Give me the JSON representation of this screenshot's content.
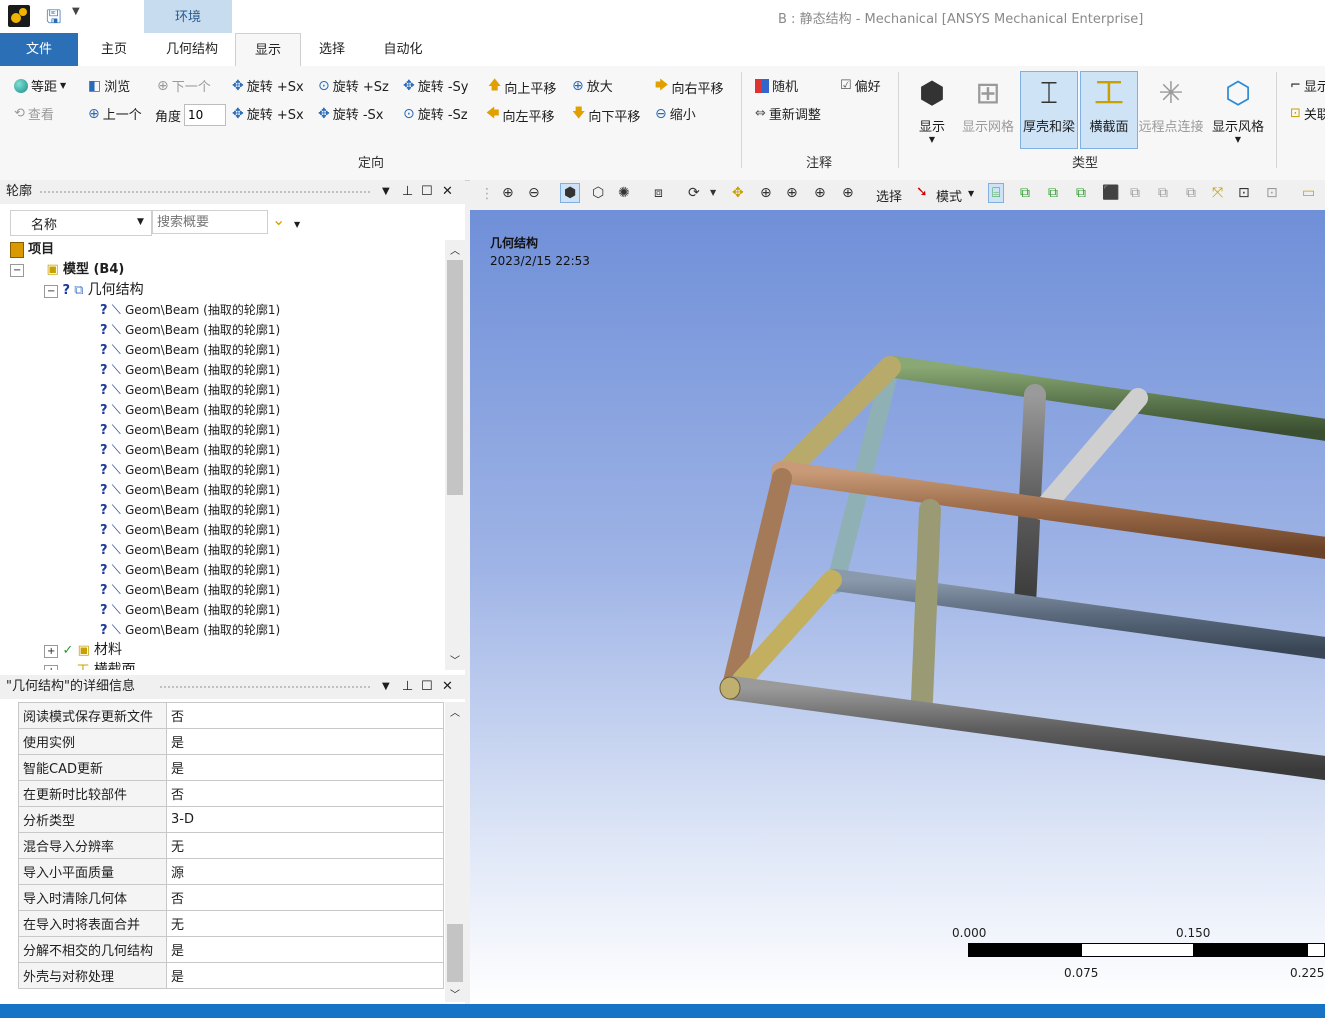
{
  "window": {
    "title": "B : 静态结构 - Mechanical [ANSYS Mechanical Enterprise]",
    "context_tab": "环境"
  },
  "menu": {
    "file": "文件",
    "tabs": [
      "主页",
      "几何结构",
      "显示",
      "选择",
      "自动化"
    ],
    "active": "显示"
  },
  "ribbon": {
    "orient": {
      "group_label": "定向",
      "isometric": "等距",
      "browse": "浏览",
      "next": "下一个",
      "previous": "上一个",
      "view": "查看",
      "angle_label": "角度",
      "angle_value": "10",
      "rot_pos_sx_1": "旋转 +Sx",
      "rot_pos_sz": "旋转 +Sz",
      "rot_neg_sy": "旋转 -Sy",
      "pan_up": "向上平移",
      "zoom_in": "放大",
      "pan_right": "向右平移",
      "rot_pos_sx_2": "旋转 +Sx",
      "rot_neg_sx": "旋转 -Sx",
      "rot_neg_sz": "旋转 -Sz",
      "pan_left": "向左平移",
      "pan_down": "向下平移",
      "zoom_out": "缩小"
    },
    "annotation": {
      "group_label": "注释",
      "random": "随机",
      "preference": "偏好",
      "rescale": "重新调整"
    },
    "type": {
      "group_label": "类型",
      "display": "显示",
      "show_mesh": "显示网格",
      "thick_beam": "厚壳和梁",
      "cross_section": "横截面",
      "remote_point": "远程点连接",
      "display_style": "显示风格"
    },
    "extra": {
      "show": "显示",
      "related": "关联"
    }
  },
  "outline": {
    "title": "轮廓",
    "filter_label": "名称",
    "search_placeholder": "搜索概要",
    "project": "项目",
    "model": "模型 (B4)",
    "geometry": "几何结构",
    "beam_items": [
      "Geom\\Beam (抽取的轮廓1)",
      "Geom\\Beam (抽取的轮廓1)",
      "Geom\\Beam (抽取的轮廓1)",
      "Geom\\Beam (抽取的轮廓1)",
      "Geom\\Beam (抽取的轮廓1)",
      "Geom\\Beam (抽取的轮廓1)",
      "Geom\\Beam (抽取的轮廓1)",
      "Geom\\Beam (抽取的轮廓1)",
      "Geom\\Beam (抽取的轮廓1)",
      "Geom\\Beam (抽取的轮廓1)",
      "Geom\\Beam (抽取的轮廓1)",
      "Geom\\Beam (抽取的轮廓1)",
      "Geom\\Beam (抽取的轮廓1)",
      "Geom\\Beam (抽取的轮廓1)",
      "Geom\\Beam (抽取的轮廓1)",
      "Geom\\Beam (抽取的轮廓1)",
      "Geom\\Beam (抽取的轮廓1)"
    ],
    "materials": "材料",
    "cross_sections": "横截面"
  },
  "details": {
    "title": "\"几何结构\"的详细信息",
    "rows": [
      {
        "k": "阅读模式保存更新文件",
        "v": "否"
      },
      {
        "k": "使用实例",
        "v": "是"
      },
      {
        "k": "智能CAD更新",
        "v": "是"
      },
      {
        "k": "在更新时比较部件",
        "v": "否"
      },
      {
        "k": "分析类型",
        "v": "3-D"
      },
      {
        "k": "混合导入分辨率",
        "v": "无"
      },
      {
        "k": "导入小平面质量",
        "v": "源"
      },
      {
        "k": "导入时清除几何体",
        "v": "否"
      },
      {
        "k": "在导入时将表面合并",
        "v": "无"
      },
      {
        "k": "分解不相交的几何结构",
        "v": "是"
      },
      {
        "k": "外壳与对称处理",
        "v": "是"
      }
    ]
  },
  "viewport": {
    "label": "几何结构",
    "timestamp": "2023/2/15 22:53",
    "toolbar_select": "选择",
    "toolbar_mode": "模式",
    "scale_top": [
      "0.000",
      "0.150"
    ],
    "scale_bottom": [
      "0.075",
      "0.225"
    ]
  },
  "colors": {
    "file_tab": "#2b6fb6",
    "status_bar": "#1773c6",
    "viewport_top": "#6f8fd8",
    "selected_button": "#cfe3f7"
  }
}
